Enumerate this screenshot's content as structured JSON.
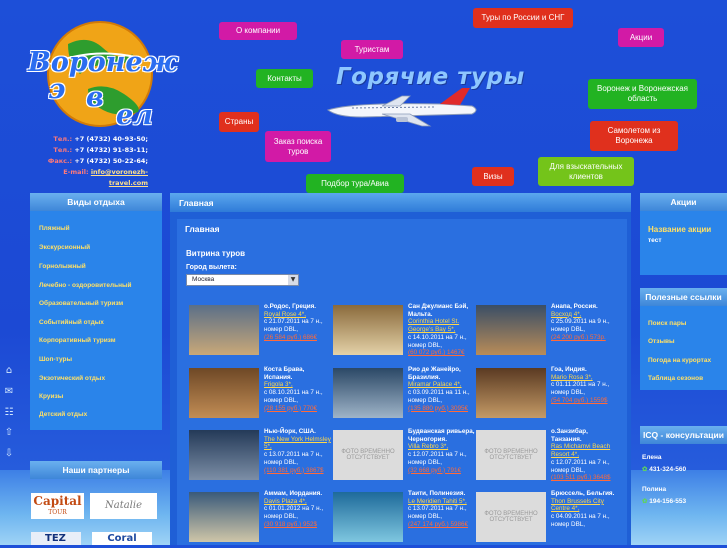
{
  "brand": {
    "logo_line1": "Воронеж",
    "logo_line2": "э",
    "logo_line3": "в",
    "logo_line4": "ел",
    "contacts": [
      {
        "label": "Тел.:",
        "value": "+7 (4732) 40-93-50;"
      },
      {
        "label": "Тел.:",
        "value": "+7 (4732) 91-83-11;"
      },
      {
        "label": "Факс.:",
        "value": "+7 (4732) 50-22-64;"
      }
    ],
    "email_label": "E-mail:",
    "email": "info@voronezh-travel.com"
  },
  "nav": {
    "about": "О компании",
    "tours_russia": "Туры по России и СНГ",
    "promotions": "Акции",
    "tourists": "Туристам",
    "contacts": "Контакты",
    "hot_tours": "Горячие туры",
    "voronezh_region": "Воронеж и Воронежская область",
    "countries": "Страны",
    "search_order": "Заказ поиска туров",
    "plane_from": "Самолетом из Воронежа",
    "visas": "Визы",
    "demanding": "Для взыскательных клиентов",
    "pick_tour": "Подбор тура/Авиа"
  },
  "left": {
    "title": "Виды отдыха",
    "items": [
      "Пляжный",
      "Экскурсионный",
      "Горнолыжный",
      "Лечебно - оздоровительный",
      "Образовательный туризм",
      "Событийный отдых",
      "Корпоративный туризм",
      "Шоп-туры",
      "Экзотический отдых",
      "Круизы",
      "Детский отдых"
    ],
    "partners_title": "Наши партнеры",
    "partner1": "Capital",
    "partner1_sub": "TOUR",
    "partner2": "Natalie",
    "partner3": "TEZ",
    "partner4": "Coral"
  },
  "main": {
    "breadcrumb": "Главная",
    "heading": "Главная",
    "vitrina": "Витрина туров",
    "city_label": "Город вылета:",
    "city_value": "Москва",
    "no_photo": "ФОТО ВРЕМЕННО ОТСУТСТВУЕТ",
    "tours": [
      {
        "name": "о.Родос, Греция.",
        "hotel": "Royal Rose 4*,",
        "l3": "с 21.07.2011 на 7 н.,",
        "l4": "номер DBL,",
        "price": "(26 584 руб.) 686€"
      },
      {
        "name": "Сан Джулианс Бэй, Мальта.",
        "hotel": "Corinthia Hotel St. George's Bay 5*,",
        "l3": "с 14.10.2011 на 7 н.,",
        "l4": "номер DBL,",
        "price": "(60 072 руб.) 1467€"
      },
      {
        "name": "Анапа, Россия.",
        "hotel": "Восход 4*,",
        "l3": "с 25.09.2011 на 9 н.,",
        "l4": "номер DBL,",
        "price": "(24 200 руб.) 573р."
      },
      {
        "name": "Коста Брава, Испания.",
        "hotel": "Frigola 3*,",
        "l3": "с 08.10.2011 на 7 н.,",
        "l4": "номер DBL,",
        "price": "(28 155 руб.) 770€"
      },
      {
        "name": "Рио де Жанейро, Бразилия.",
        "hotel": "Miramar Palace 4*,",
        "l3": "с 03.09.2011 на 11 н.,",
        "l4": "номер DBL,",
        "price": "(135 880 руб.) 3095€"
      },
      {
        "name": "Гоа, Индия.",
        "hotel": "Mario Rosa 3*,",
        "l3": "с 01.11.2011 на 7 н.,",
        "l4": "номер DBL,",
        "price": "(54 704 руб.) 1559$"
      },
      {
        "name": "Нью-Йорк, США.",
        "hotel": "The New York Helmsley 5*,",
        "l3": "с 13.07.2011 на 7 н.,",
        "l4": "номер DBL,",
        "price": "(110 381 руб.) 3867$"
      },
      {
        "name": "Будванская ривьера, Черногория.",
        "hotel": "Villa Rebro 3*,",
        "l3": "с 12.07.2011 на 7 н.,",
        "l4": "номер DBL,",
        "price": "(32 668 руб.) 791€"
      },
      {
        "name": "о.Занзибар, Танзания.",
        "hotel": "Ras Michamvi Beach Resort 4*,",
        "l3": "с 12.07.2011 на 7 н.,",
        "l4": "номер DBL,",
        "price": "(103 511 руб.) 3648$"
      },
      {
        "name": "Аммам, Иордания.",
        "hotel": "Davis Plaza 4*,",
        "l3": "с 01.01.2012 на 7 н.,",
        "l4": "номер DBL,",
        "price": "(30 918 руб.) 952$"
      },
      {
        "name": "Таити, Полинезия.",
        "hotel": "Le Meridien Tahiti 5*,",
        "l3": "с 13.07.2011 на 7 н.,",
        "l4": "номер DBL,",
        "price": "(247 174 руб.) 5986€"
      },
      {
        "name": "Брюссель, Бельгия.",
        "hotel": "Thon Brussels City Centre 4*,",
        "l3": "с 04.09.2011 на 7 н.,",
        "l4": "номер DBL,",
        "price": ""
      }
    ]
  },
  "right": {
    "promo_title": "Акции",
    "promo_name": "Название акции",
    "promo_text": "тест",
    "links_title": "Полезные ссылки",
    "links": [
      "Поиск пары",
      "Отзывы",
      "Погода на курортах",
      "Таблица сезонов"
    ],
    "icq_title": "ICQ - консультации",
    "icq1_name": "Елена",
    "icq1_num": "431-324-560",
    "icq2_name": "Полина",
    "icq2_num": "194-156-553"
  },
  "colors": {
    "accent": "#d21aa6",
    "red": "#e0301d",
    "green": "#22b322",
    "link": "#ffe066"
  }
}
